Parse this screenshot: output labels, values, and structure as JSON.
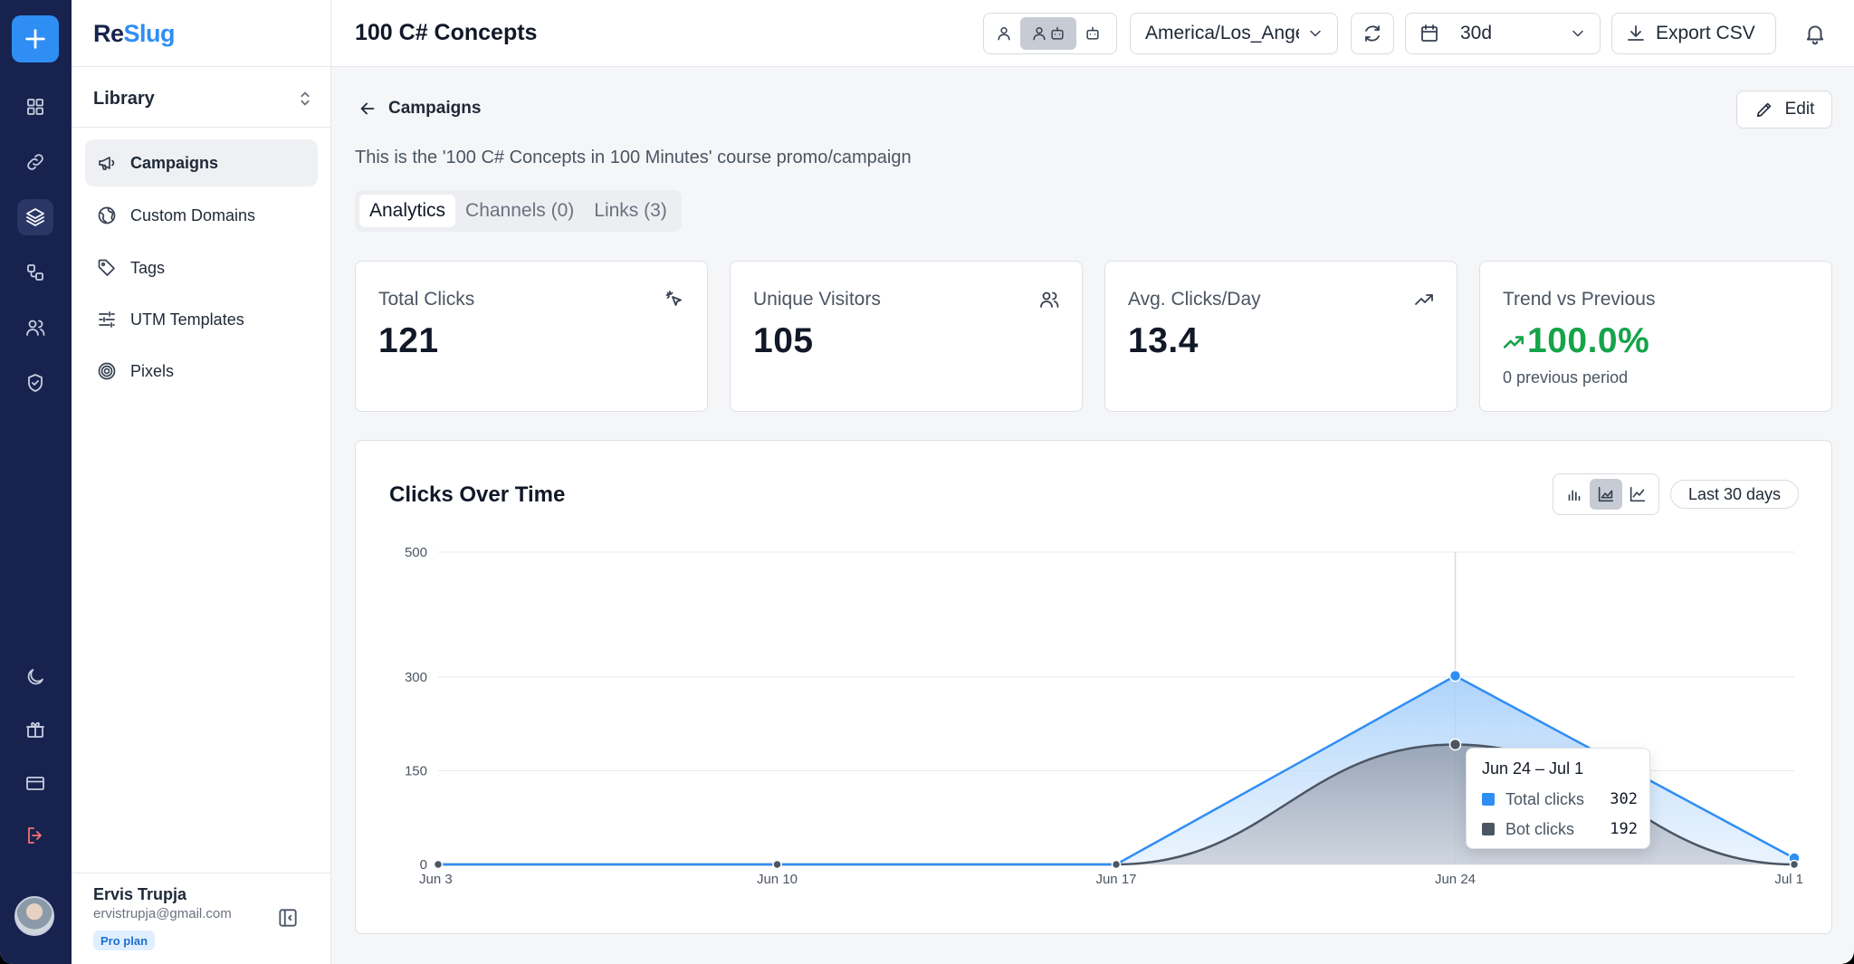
{
  "app": {
    "brand_part1": "Re",
    "brand_part2": "Slug",
    "library_label": "Library"
  },
  "sidebar": {
    "items": [
      {
        "label": "Campaigns",
        "icon": "megaphone-icon",
        "active": true
      },
      {
        "label": "Custom Domains",
        "icon": "globe-icon"
      },
      {
        "label": "Tags",
        "icon": "tag-icon"
      },
      {
        "label": "UTM Templates",
        "icon": "sliders-icon"
      },
      {
        "label": "Pixels",
        "icon": "target-icon"
      }
    ]
  },
  "user": {
    "name": "Ervis Trupja",
    "email": "ervistrupja@gmail.com",
    "plan": "Pro plan"
  },
  "header": {
    "title": "100 C# Concepts",
    "timezone": "America/Los_Angeles",
    "date_range": "30d",
    "export_label": "Export CSV"
  },
  "page": {
    "back_label": "Campaigns",
    "edit_label": "Edit",
    "description": "This is the '100 C# Concepts in 100 Minutes' course promo/campaign",
    "tabs": [
      {
        "label": "Analytics",
        "active": true
      },
      {
        "label": "Channels (0)"
      },
      {
        "label": "Links (3)"
      }
    ]
  },
  "stats": [
    {
      "label": "Total Clicks",
      "value": "121",
      "icon": "cursor-click-icon"
    },
    {
      "label": "Unique Visitors",
      "value": "105",
      "icon": "users-icon"
    },
    {
      "label": "Avg. Clicks/Day",
      "value": "13.4",
      "icon": "trending-up-icon"
    },
    {
      "label": "Trend vs Previous",
      "value": "100.0%",
      "sub": "0 previous period",
      "icon": "trending-up-icon"
    }
  ],
  "chart_section": {
    "title": "Clicks Over Time",
    "range_label": "Last 30 days"
  },
  "chart_data": {
    "type": "area",
    "title": "Clicks Over Time",
    "categories": [
      "Jun 3",
      "Jun 10",
      "Jun 17",
      "Jun 24",
      "Jul 1"
    ],
    "series": [
      {
        "name": "Total clicks",
        "values": [
          0,
          0,
          0,
          302,
          10
        ],
        "color": "#2f8ef4"
      },
      {
        "name": "Bot clicks",
        "values": [
          0,
          0,
          0,
          192,
          0
        ],
        "color": "#4b5563"
      }
    ],
    "y_ticks": [
      0,
      150,
      300,
      500
    ],
    "ylim": [
      0,
      500
    ],
    "grid": true,
    "tooltip": {
      "title": "Jun 24 – Jul 1",
      "rows": [
        {
          "label": "Total clicks",
          "value": "302"
        },
        {
          "label": "Bot clicks",
          "value": "192"
        }
      ]
    }
  },
  "colors": {
    "rail_bg": "#17234e",
    "accent": "#2f8ef4",
    "success": "#16a34a",
    "bot_series": "#4b5563"
  }
}
